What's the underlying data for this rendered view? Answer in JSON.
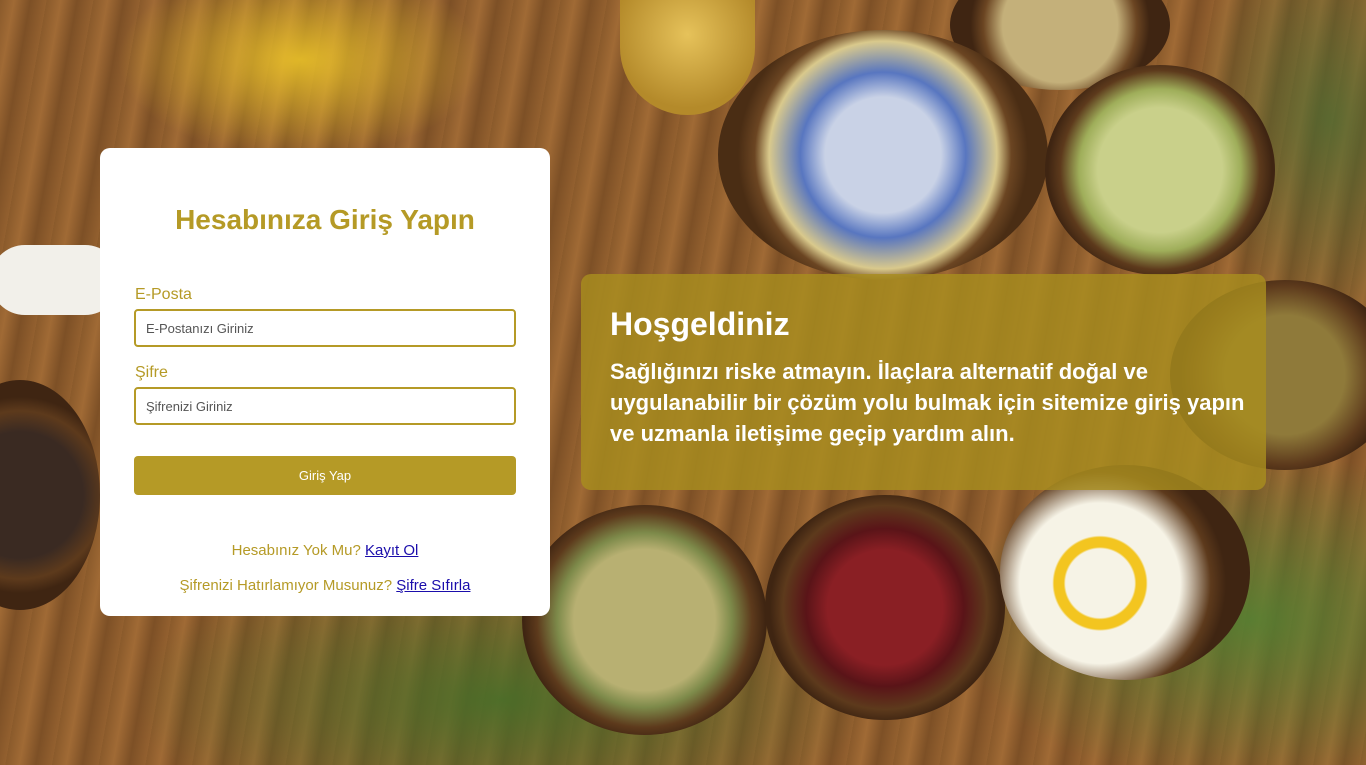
{
  "login": {
    "title": "Hesabınıza Giriş Yapın",
    "email_label": "E-Posta",
    "email_placeholder": "E-Postanızı Giriniz",
    "email_value": "",
    "password_label": "Şifre",
    "password_placeholder": "Şifrenizi Giriniz",
    "password_value": "",
    "submit_label": "Giriş Yap",
    "no_account_text": "Hesabınız Yok Mu? ",
    "register_link": "Kayıt Ol",
    "forgot_text": "Şifrenizi Hatırlamıyor Musunuz? ",
    "reset_link": "Şifre Sıfırla"
  },
  "welcome": {
    "title": "Hoşgeldiniz",
    "text": "Sağlığınızı riske atmayın. İlaçlara alternatif doğal ve uygulanabilir bir çözüm yolu bulmak için sitemize giriş yapın ve uzmanla iletişime geçip yardım alın."
  },
  "colors": {
    "accent": "#b59a26",
    "welcome_box": "#a88e1e",
    "link": "#1a0dab"
  }
}
